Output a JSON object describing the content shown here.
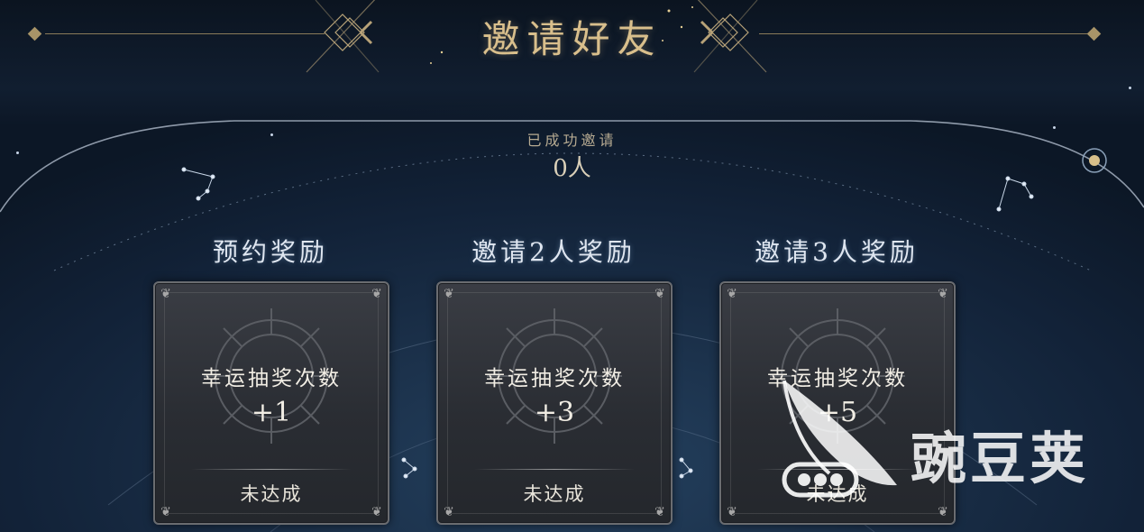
{
  "header": {
    "title": "邀请好友"
  },
  "invite_status": {
    "label": "已成功邀请",
    "count": "0人"
  },
  "rewards": [
    {
      "title": "预约奖励",
      "reward_name": "幸运抽奖次数",
      "amount": "+1",
      "status": "未达成"
    },
    {
      "title": "邀请2人奖励",
      "reward_name": "幸运抽奖次数",
      "amount": "+3",
      "status": "未达成"
    },
    {
      "title": "邀请3人奖励",
      "reward_name": "幸运抽奖次数",
      "amount": "+5",
      "status": "未达成"
    }
  ],
  "watermark": {
    "text": "豌豆荚"
  },
  "colors": {
    "gold": "#d9bf8c",
    "background": "#1a2f48",
    "card": "#2f3238"
  }
}
